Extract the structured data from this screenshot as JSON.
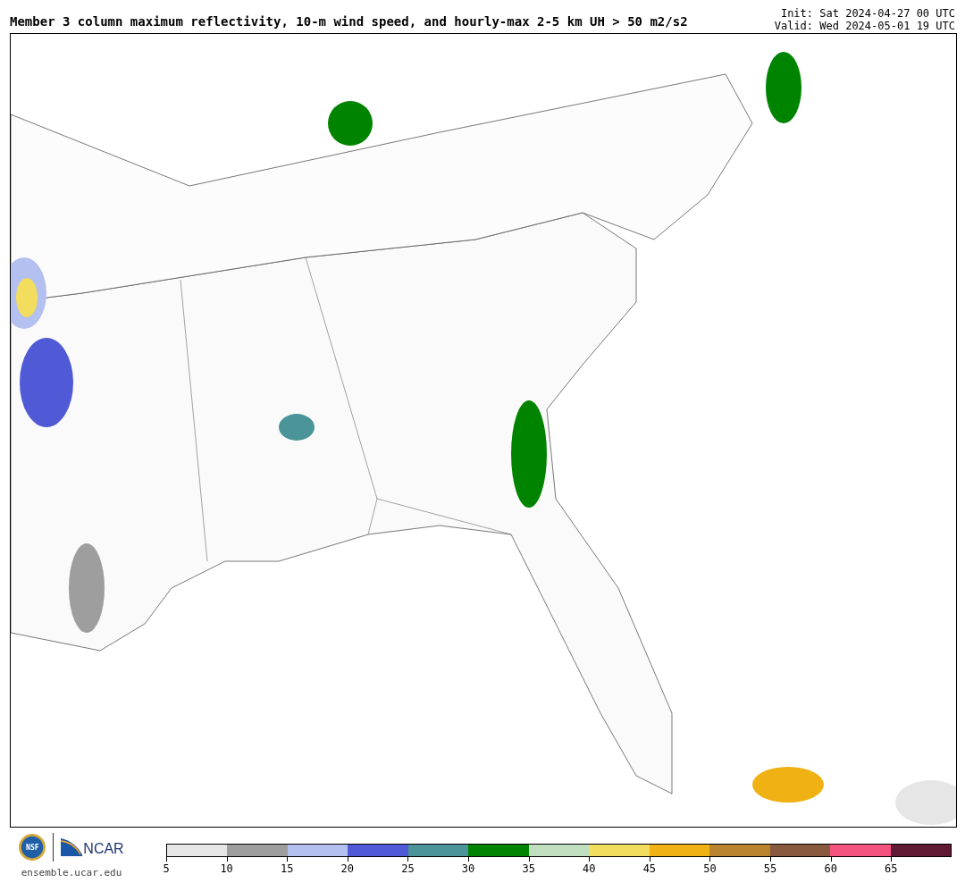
{
  "title": "Member 3 column maximum reflectivity, 10-m wind speed, and hourly-max 2-5 km UH > 50 m2/s2",
  "init": "Init: Sat 2024-04-27 00 UTC",
  "valid": "Valid: Wed 2024-05-01 19 UTC",
  "logos": {
    "nsf": "NSF",
    "ncar": "NCAR",
    "site": "ensemble.ucar.edu"
  },
  "colorbar": {
    "bins": [
      {
        "color": "#e6e6e6",
        "tick": "5"
      },
      {
        "color": "#9e9e9e",
        "tick": "10"
      },
      {
        "color": "#b4c0ef",
        "tick": "15"
      },
      {
        "color": "#505ad6",
        "tick": "20"
      },
      {
        "color": "#4a949a",
        "tick": "25"
      },
      {
        "color": "#008400",
        "tick": "30"
      },
      {
        "color": "#bfdfbf",
        "tick": "35"
      },
      {
        "color": "#f2dd5e",
        "tick": "40"
      },
      {
        "color": "#f0b114",
        "tick": "45"
      },
      {
        "color": "#ba842e",
        "tick": "50"
      },
      {
        "color": "#8a5a3e",
        "tick": "55"
      },
      {
        "color": "#f5537f",
        "tick": "60"
      },
      {
        "color": "#611a36",
        "tick": "65"
      }
    ]
  }
}
